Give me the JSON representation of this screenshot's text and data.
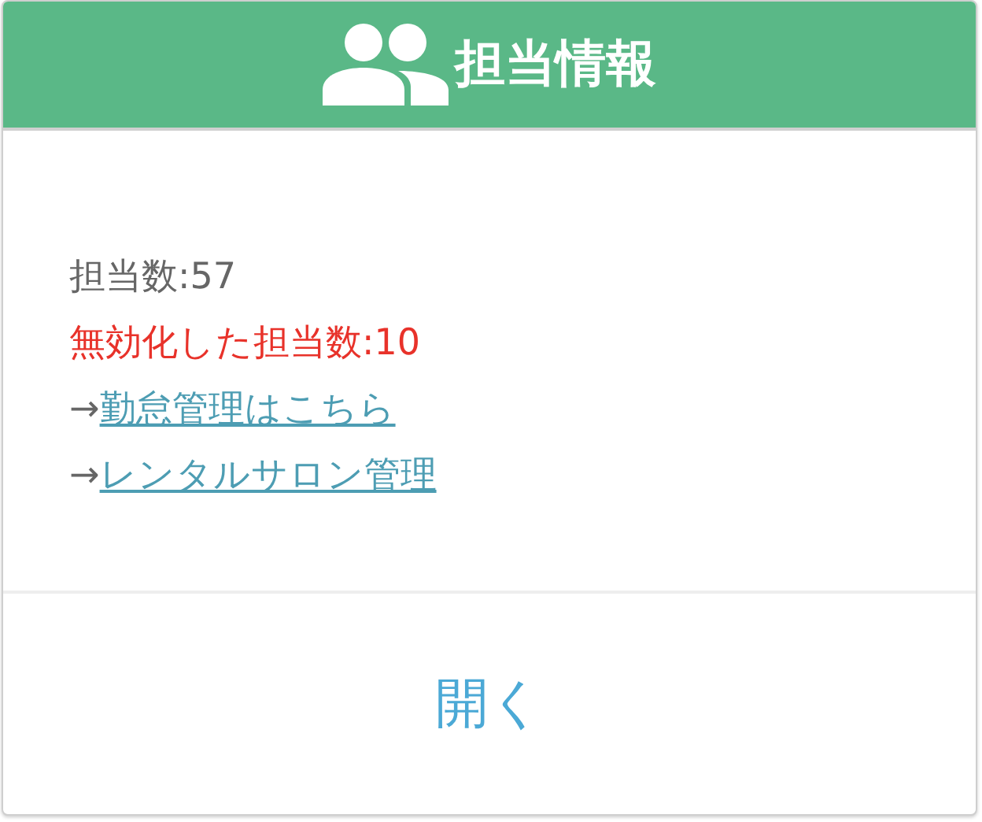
{
  "header": {
    "title": "担当情報"
  },
  "lines": [
    {
      "kind": "stat",
      "text": "担当数:57"
    },
    {
      "kind": "warning",
      "text": "無効化した担当数:10"
    },
    {
      "kind": "link",
      "arrow": "→",
      "text": "勤怠管理はこちら"
    },
    {
      "kind": "link",
      "arrow": "→",
      "text": "レンタルサロン管理"
    }
  ],
  "footer": {
    "button": "開く"
  }
}
